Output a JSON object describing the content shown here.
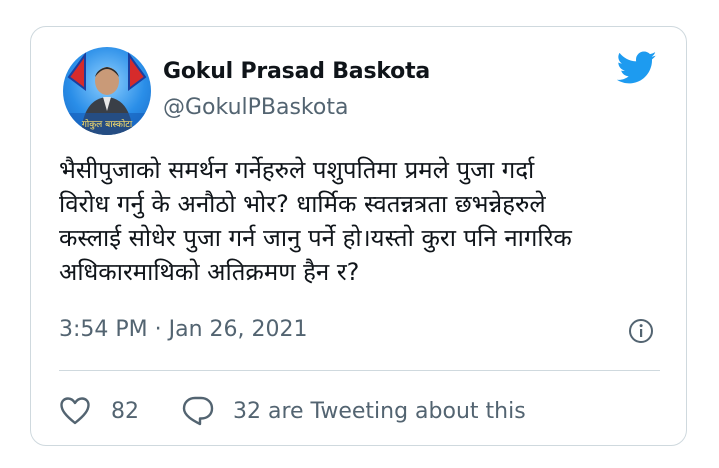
{
  "author": {
    "display_name": "Gokul Prasad Baskota",
    "handle": "@GokulPBaskota",
    "avatar_caption": "गोकुल बास्कोटा"
  },
  "tweet": {
    "lines": [
      "भैसीपुजाको समर्थन गर्नेहरुले पशुपतिमा प्रमले पुजा गर्दा",
      "विरोध गर्नु के अनौठो भोर? धार्मिक स्वतन्नत्रता छभन्नेहरुले",
      "कस्लाई सोधेर पुजा गर्न जानु पर्ने हो।यस्तो कुरा पनि नागरिक",
      "अधिकारमाथिको अतिक्रमण हैन र?"
    ],
    "timestamp": "3:54 PM · Jan 26, 2021"
  },
  "engagement": {
    "likes": "82",
    "tweeting_about": "32 are Tweeting about this"
  },
  "icons": {
    "brand": "twitter-bird-icon",
    "info": "info-icon",
    "like": "heart-icon",
    "reply": "speech-bubble-icon"
  },
  "colors": {
    "brand_blue": "#1d9bf0",
    "text_primary": "#0f1419",
    "text_secondary": "#536471",
    "border": "#cfd9de"
  }
}
